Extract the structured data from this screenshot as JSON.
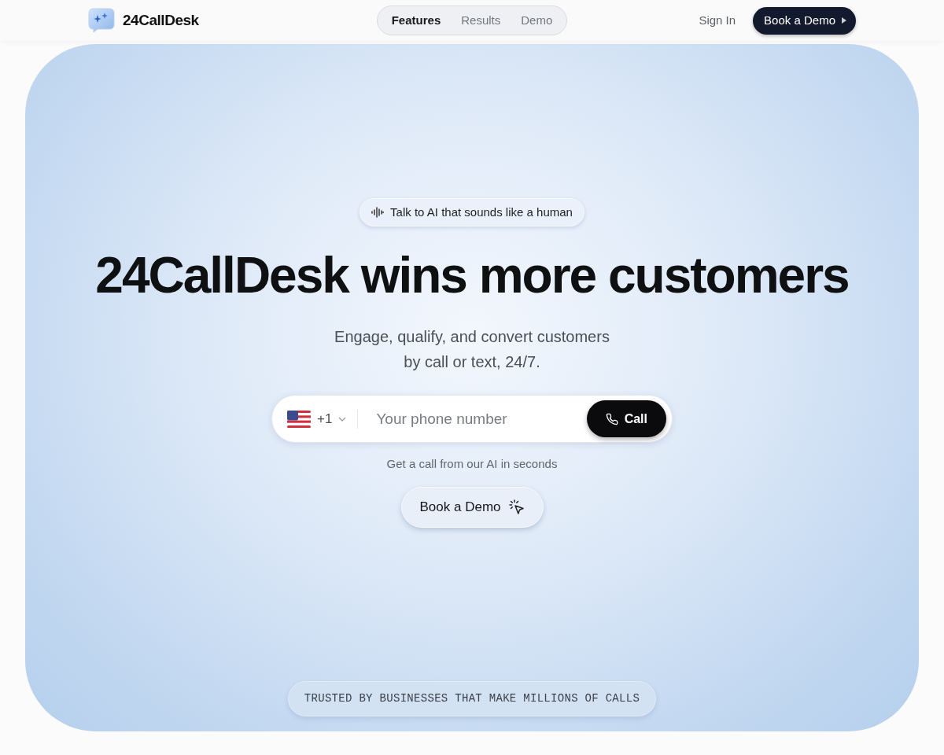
{
  "nav": {
    "brand": "24CallDesk",
    "links": [
      {
        "label": "Features",
        "selected": true
      },
      {
        "label": "Results",
        "selected": false
      },
      {
        "label": "Demo",
        "selected": false
      }
    ],
    "sign_in": "Sign In",
    "cta": "Book a Demo"
  },
  "hero": {
    "badge": "Talk to AI that sounds like a human",
    "title": "24CallDesk wins more customers",
    "subtitle_lines": [
      "Engage, qualify, and convert customers",
      "by call or text, 24/7."
    ],
    "phone_form": {
      "country_code": "+1",
      "placeholder": "Your phone number",
      "button": "Call"
    },
    "hint": "Get a call from our AI in seconds",
    "demo_button": "Book a Demo",
    "trust_badge": "TRUSTED BY BUSINESSES THAT MAKE MILLIONS OF CALLS"
  }
}
